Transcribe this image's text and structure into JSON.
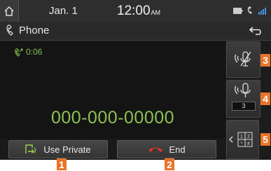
{
  "status_bar": {
    "date": "Jan.  1",
    "time": "12:00",
    "ampm": "AM"
  },
  "title_bar": {
    "title": "Phone"
  },
  "call": {
    "duration": "0:06",
    "number": "000-000-00000"
  },
  "side_controls": {
    "volume_level": "3"
  },
  "bottom_bar": {
    "use_private_label": "Use Private",
    "end_label": "End"
  },
  "callouts": [
    "1",
    "2",
    "3",
    "4",
    "5"
  ],
  "colors": {
    "accent_green": "#8cc152",
    "callout_orange": "#e8742a",
    "end_red": "#d9342b"
  },
  "icons": [
    "home-icon",
    "battery-icon",
    "phone-signal-icon",
    "bluetooth-signal-icon",
    "phone-icon",
    "back-icon",
    "outgoing-call-icon",
    "mic-off-icon",
    "mic-volume-icon",
    "chevron-left-icon",
    "keypad-icon",
    "private-icon",
    "end-call-icon"
  ]
}
